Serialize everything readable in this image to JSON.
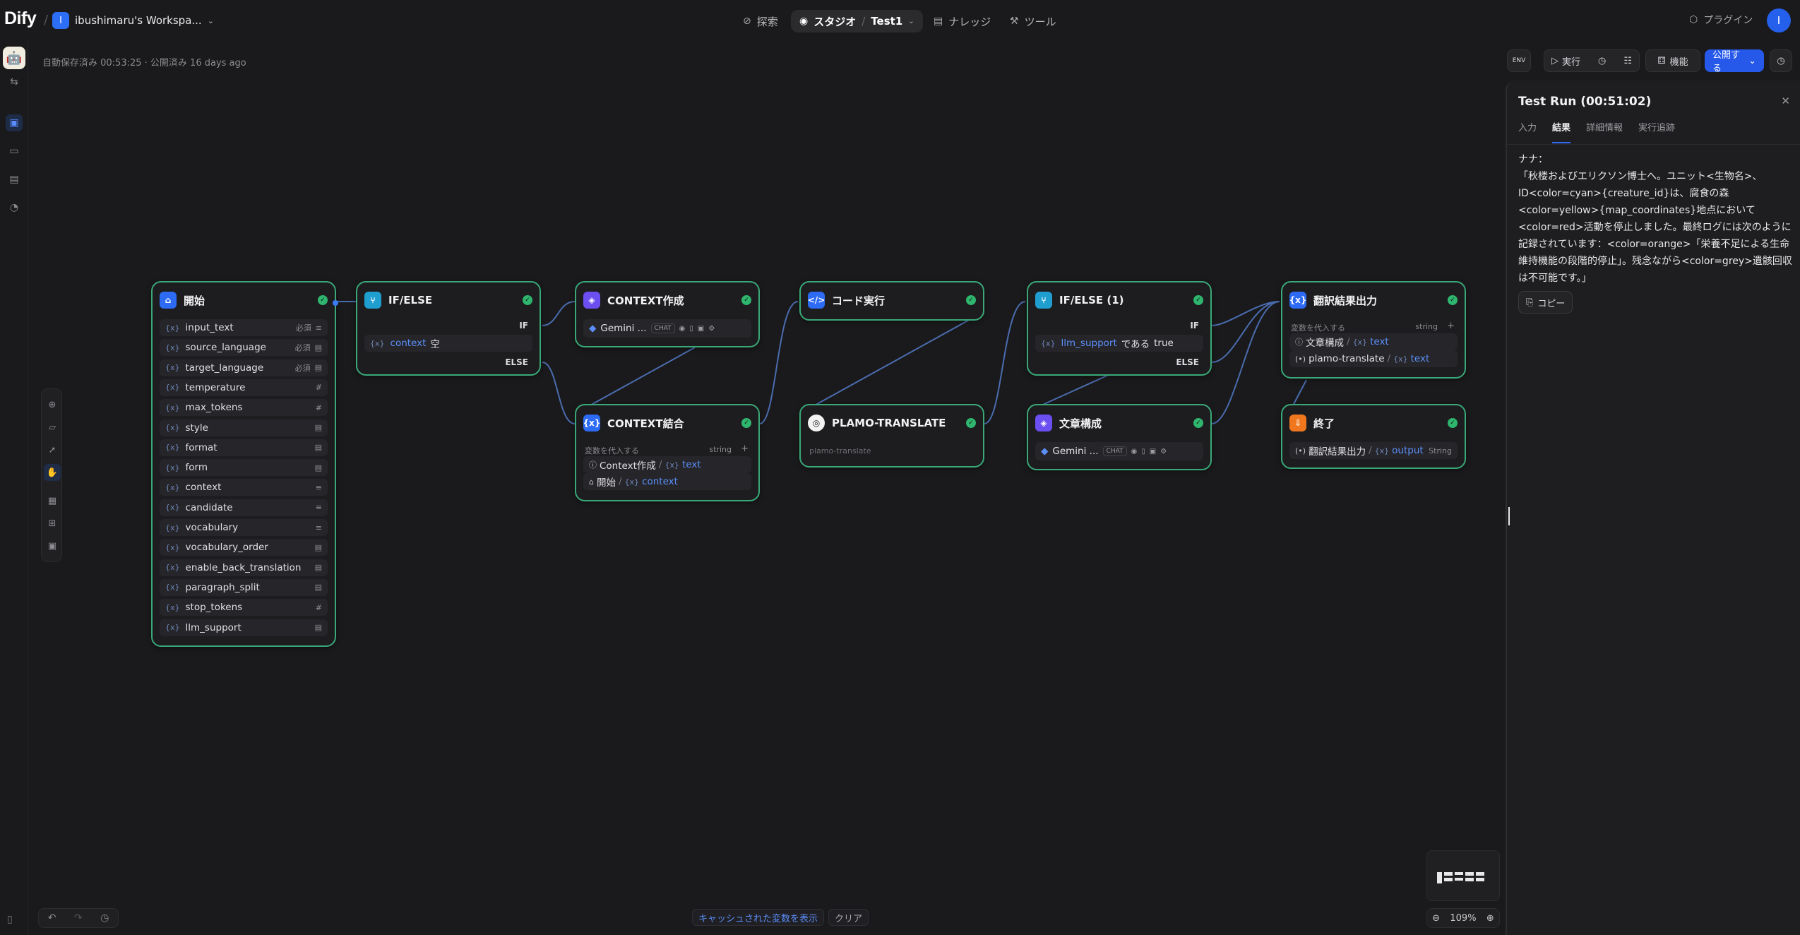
{
  "brand": {
    "logo_text": "Dify"
  },
  "workspace": {
    "badge": "I",
    "name": "ibushimaru's Workspa..."
  },
  "nav": {
    "explore": "探索",
    "studio": "スタジオ",
    "app": "Test1",
    "knowledge": "ナレッジ",
    "tools": "ツール",
    "plugins": "プラグイン",
    "avatar": "I"
  },
  "header": {
    "autosave": "自動保存済み 00:53:25 · 公開済み 16 days ago",
    "env_label": "ENV",
    "run": "実行",
    "features": "機能",
    "publish": "公開する"
  },
  "nodes": {
    "start": {
      "title": "開始",
      "vars": [
        {
          "name": "input_text",
          "meta": "必須",
          "icon": "paragraph-icon"
        },
        {
          "name": "source_language",
          "meta": "必須",
          "icon": "text-icon"
        },
        {
          "name": "target_language",
          "meta": "必須",
          "icon": "text-icon"
        },
        {
          "name": "temperature",
          "meta": "",
          "icon": "number-icon"
        },
        {
          "name": "max_tokens",
          "meta": "",
          "icon": "number-icon"
        },
        {
          "name": "style",
          "meta": "",
          "icon": "text-icon"
        },
        {
          "name": "format",
          "meta": "",
          "icon": "text-icon"
        },
        {
          "name": "form",
          "meta": "",
          "icon": "text-icon"
        },
        {
          "name": "context",
          "meta": "",
          "icon": "paragraph-icon"
        },
        {
          "name": "candidate",
          "meta": "",
          "icon": "paragraph-icon"
        },
        {
          "name": "vocabulary",
          "meta": "",
          "icon": "paragraph-icon"
        },
        {
          "name": "vocabulary_order",
          "meta": "",
          "icon": "text-icon"
        },
        {
          "name": "enable_back_translation",
          "meta": "",
          "icon": "text-icon"
        },
        {
          "name": "paragraph_split",
          "meta": "",
          "icon": "text-icon"
        },
        {
          "name": "stop_tokens",
          "meta": "",
          "icon": "number-icon"
        },
        {
          "name": "llm_support",
          "meta": "",
          "icon": "text-icon"
        }
      ]
    },
    "ifelse1": {
      "title": "IF/ELSE",
      "if_label": "IF",
      "else_label": "ELSE",
      "cond_var": "context",
      "cond_op": "空"
    },
    "ctx_create": {
      "title": "CONTEXT作成",
      "model": "Gemini ...",
      "mode": "CHAT"
    },
    "ctx_merge": {
      "title": "CONTEXT結合",
      "assign_label": "変数を代入する",
      "type": "string",
      "rows": [
        {
          "node": "Context作成",
          "var": "text"
        },
        {
          "node": "開始",
          "var": "context"
        }
      ]
    },
    "code": {
      "title": "コード実行"
    },
    "plamo": {
      "title": "PLAMO-TRANSLATE",
      "sub": "plamo-translate"
    },
    "ifelse2": {
      "title": "IF/ELSE (1)",
      "if_label": "IF",
      "else_label": "ELSE",
      "cond_var": "llm_support",
      "cond_op": "である",
      "cond_val": "true"
    },
    "compose": {
      "title": "文章構成",
      "model": "Gemini ...",
      "mode": "CHAT"
    },
    "output": {
      "title": "翻訳結果出力",
      "assign_label": "変数を代入する",
      "type": "string",
      "rows": [
        {
          "node": "文章構成",
          "var": "text"
        },
        {
          "node": "plamo-translate",
          "var": "text"
        }
      ]
    },
    "end": {
      "title": "終了",
      "node": "翻訳結果出力",
      "var": "output",
      "type": "String"
    }
  },
  "canvas": {
    "show_cached": "キャッシュされた変数を表示",
    "clear": "クリア",
    "zoom": "109%"
  },
  "panel": {
    "title": "Test Run (00:51:02)",
    "tabs": [
      "入力",
      "結果",
      "詳細情報",
      "実行追跡"
    ],
    "active_tab": "結果",
    "result": "ナナ：\n「秋楼およびエリクソン博士へ。ユニット<生物名>、ID<color=cyan>{creature_id}は、腐食の森<color=yellow>{map_coordinates}地点において<color=red>活動を停止しました。最終ログには次のように記録されています：<color=orange>「栄養不足による生命維持機能の段階的停止」。残念ながら<color=grey>遺骸回収は不可能です。」",
    "copy": "コピー"
  },
  "colors": {
    "accent": "#2659ea",
    "node_border": "#3aa878",
    "success": "#2fb56d",
    "edge": "#4a6cae"
  }
}
